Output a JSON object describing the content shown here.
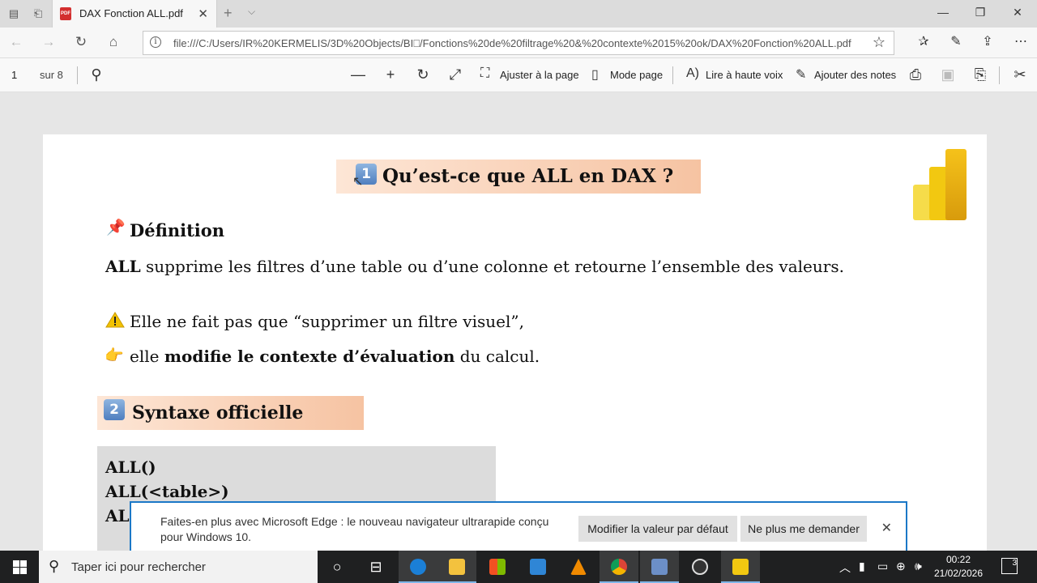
{
  "tab": {
    "title": "DAX Fonction ALL.pdf",
    "pdf_badge": "PDF"
  },
  "address": {
    "url": "file:///C:/Users/IR%20KERMELIS/3D%20Objects/BI⎕/Fonctions%20de%20filtrage%20&%20contexte%2015%20ok/DAX%20Fonction%20ALL.pdf"
  },
  "pdf_toolbar": {
    "page_number": "1",
    "page_total": "sur 8",
    "fit_page": "Ajuster à la page",
    "page_mode": "Mode page",
    "read_aloud": "Lire à haute voix",
    "add_notes": "Ajouter des notes"
  },
  "document": {
    "heading1_number": "1",
    "heading1": "Qu’est-ce que ALL en DAX ?",
    "definition_title": "Définition",
    "definition_bold": "ALL",
    "definition_text": " supprime les filtres d’une table ou d’une colonne et retourne l’ensemble des valeurs.",
    "note_line1": "Elle ne fait pas que “supprimer un filtre visuel”,",
    "note_line2_pre": "elle ",
    "note_line2_bold": "modifie le contexte d’évaluation",
    "note_line2_post": " du calcul.",
    "heading2_number": "2",
    "heading2": "Syntaxe officielle",
    "code": [
      "ALL()",
      "ALL(<table>)",
      "AL"
    ]
  },
  "notification": {
    "message": "Faites-en plus avec Microsoft Edge : le nouveau navigateur ultrarapide conçu pour Windows 10.",
    "set_default": "Modifier la valeur par défaut",
    "dont_ask": "Ne plus me demander"
  },
  "taskbar": {
    "search_placeholder": "Taper ici pour rechercher",
    "time": "00:22",
    "date": "21/02/2026",
    "notification_count": "3"
  },
  "colors": {
    "heading_gradient_start": "#fde6d6",
    "heading_gradient_end": "#f6c3a2",
    "code_background": "#dcdcdc",
    "notification_border": "#1b78c7",
    "powerbi_yellow": "#f2c811"
  }
}
